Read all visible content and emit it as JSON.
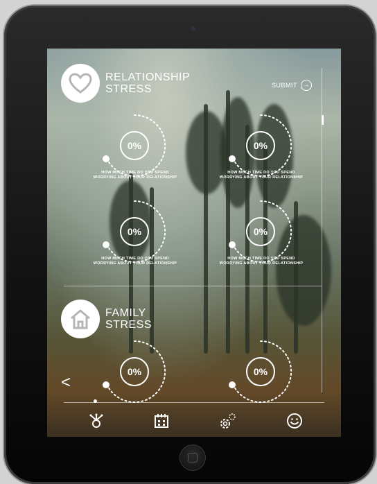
{
  "sections": [
    {
      "title_line1": "RELATIONSHIP",
      "title_line2": "STRESS",
      "icon": "heart-icon",
      "questions": [
        {
          "value": "0%",
          "text": "HOW MUCH TIME DO YOU SPEND WORRYING ABOUT YOUR RELATIONSHIP"
        },
        {
          "value": "0%",
          "text": "HOW MUCH TIME DO YOU SPEND WORRYING ABOUT YOUR RELATIONSHIP"
        },
        {
          "value": "0%",
          "text": "HOW MUCH TIME DO YOU SPEND WORRYING ABOUT YOUR RELATIONSHIP"
        },
        {
          "value": "0%",
          "text": "HOW MUCH TIME DO YOU SPEND WORRYING ABOUT YOUR RELATIONSHIP"
        }
      ]
    },
    {
      "title_line1": "FAMILY",
      "title_line2": "STRESS",
      "icon": "house-icon",
      "questions": [
        {
          "value": "0%",
          "text": ""
        },
        {
          "value": "0%",
          "text": ""
        }
      ]
    }
  ],
  "submit_label": "SUBMIT",
  "back_label": "<",
  "tabs": [
    {
      "name": "stress-tab",
      "icon": "person-icon",
      "active": true
    },
    {
      "name": "calendar-tab",
      "icon": "calendar-icon",
      "active": false
    },
    {
      "name": "settings-tab",
      "icon": "gear-icon",
      "active": false
    },
    {
      "name": "mood-tab",
      "icon": "smiley-icon",
      "active": false
    }
  ],
  "colors": {
    "text": "#ffffff",
    "bezel": "#111111"
  }
}
